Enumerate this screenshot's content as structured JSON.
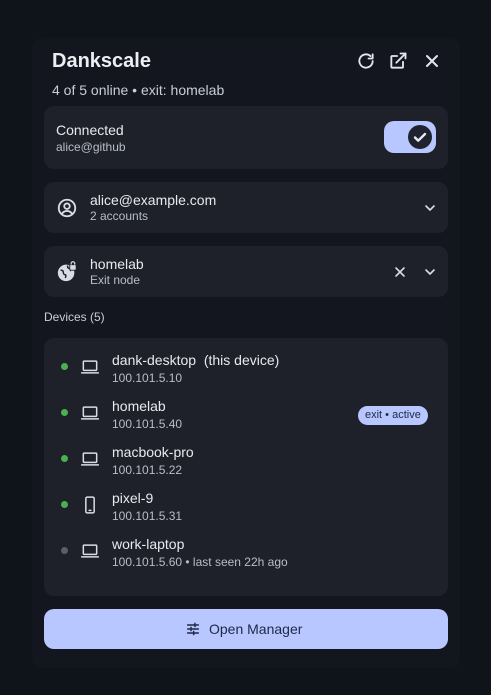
{
  "header": {
    "title": "Dankscale",
    "subtitle": "4 of 5 online • exit: homelab",
    "refresh_icon": "refresh-icon",
    "popout_icon": "external-link-icon",
    "close_icon": "close-icon"
  },
  "connection": {
    "status": "Connected",
    "account": "alice@github",
    "toggle_on": true
  },
  "account_selector": {
    "email": "alice@example.com",
    "detail": "2 accounts",
    "icon": "user-circle-icon"
  },
  "exit_node": {
    "name": "homelab",
    "detail": "Exit node",
    "icon": "globe-lock-icon"
  },
  "devices": {
    "label": "Devices (5)",
    "items": [
      {
        "name": "dank-desktop  (this device)",
        "ip": "100.101.5.10",
        "online": true,
        "type": "laptop-icon",
        "badge": ""
      },
      {
        "name": "homelab",
        "ip": "100.101.5.40",
        "online": true,
        "type": "laptop-icon",
        "badge": "exit • active"
      },
      {
        "name": "macbook-pro",
        "ip": "100.101.5.22",
        "online": true,
        "type": "laptop-icon",
        "badge": ""
      },
      {
        "name": "pixel-9",
        "ip": "100.101.5.31",
        "online": true,
        "type": "phone-icon",
        "badge": ""
      },
      {
        "name": "work-laptop",
        "ip": "100.101.5.60 • last seen 22h ago",
        "online": false,
        "type": "laptop-icon",
        "badge": ""
      }
    ]
  },
  "footer": {
    "open_manager_label": "Open Manager",
    "icon": "sliders-icon"
  },
  "colors": {
    "accent": "#b8c7ff",
    "online": "#4caf50",
    "offline": "#5a5e68",
    "card": "#1e2129",
    "background": "#0f131a"
  }
}
